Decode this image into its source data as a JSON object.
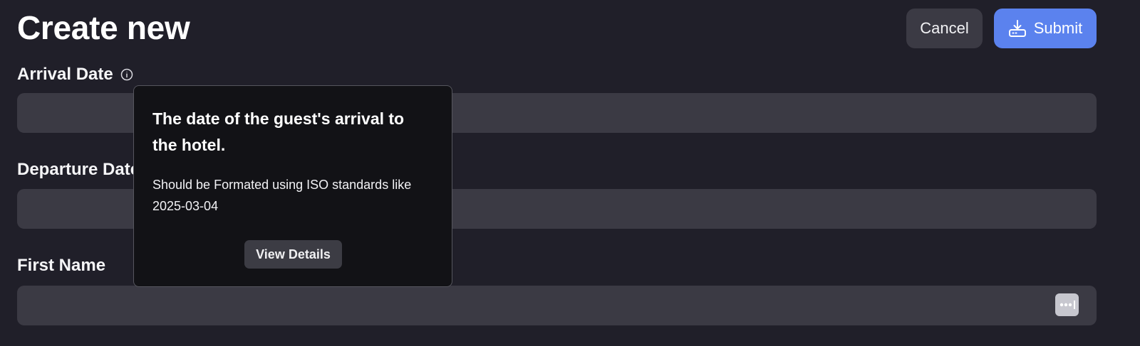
{
  "page": {
    "title": "Create new"
  },
  "header": {
    "cancel_label": "Cancel",
    "submit_label": "Submit",
    "submit_icon": "download-tray-icon"
  },
  "fields": {
    "arrival_date": {
      "label": "Arrival Date",
      "value": "",
      "info_icon": "info-circle-icon"
    },
    "departure_date": {
      "label": "Departure Date",
      "value": ""
    },
    "first_name": {
      "label": "First Name",
      "value": "",
      "autofill_icon": "password-manager-icon"
    }
  },
  "tooltip": {
    "title": "The date of the guest's arrival to the hotel.",
    "body": "Should be Formated using ISO standards like 2025-03-04",
    "button_label": "View Details"
  },
  "colors": {
    "background": "#201f29",
    "input": "#3b3a44",
    "primary": "#5b82ee",
    "tooltip_bg": "#121216"
  }
}
